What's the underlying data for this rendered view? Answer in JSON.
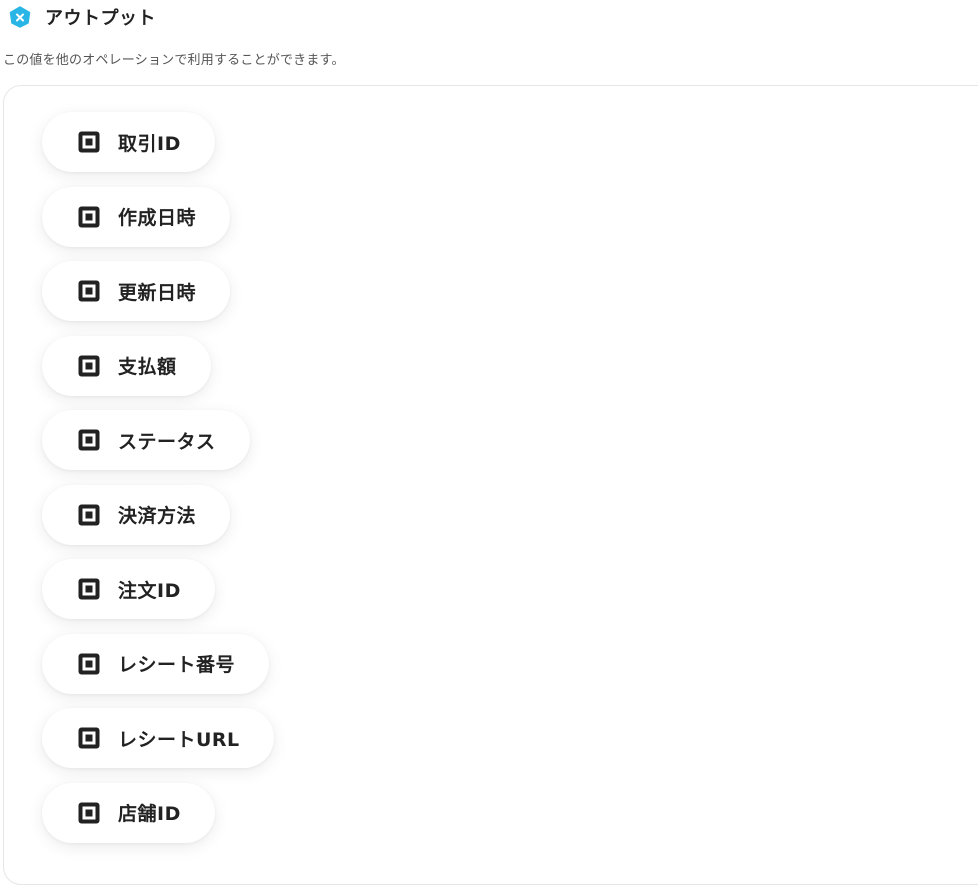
{
  "header": {
    "brand_icon": "x-hexagon-logo-icon",
    "brand_color": "#29b6e6",
    "title": "アウトプット"
  },
  "description": "この値を他のオペレーションで利用することができます。",
  "outputs": [
    {
      "label": "取引ID",
      "icon": "square-target-icon"
    },
    {
      "label": "作成日時",
      "icon": "square-target-icon"
    },
    {
      "label": "更新日時",
      "icon": "square-target-icon"
    },
    {
      "label": "支払額",
      "icon": "square-target-icon"
    },
    {
      "label": "ステータス",
      "icon": "square-target-icon"
    },
    {
      "label": "決済方法",
      "icon": "square-target-icon"
    },
    {
      "label": "注文ID",
      "icon": "square-target-icon"
    },
    {
      "label": "レシート番号",
      "icon": "square-target-icon"
    },
    {
      "label": "レシートURL",
      "icon": "square-target-icon"
    },
    {
      "label": "店舗ID",
      "icon": "square-target-icon"
    }
  ]
}
